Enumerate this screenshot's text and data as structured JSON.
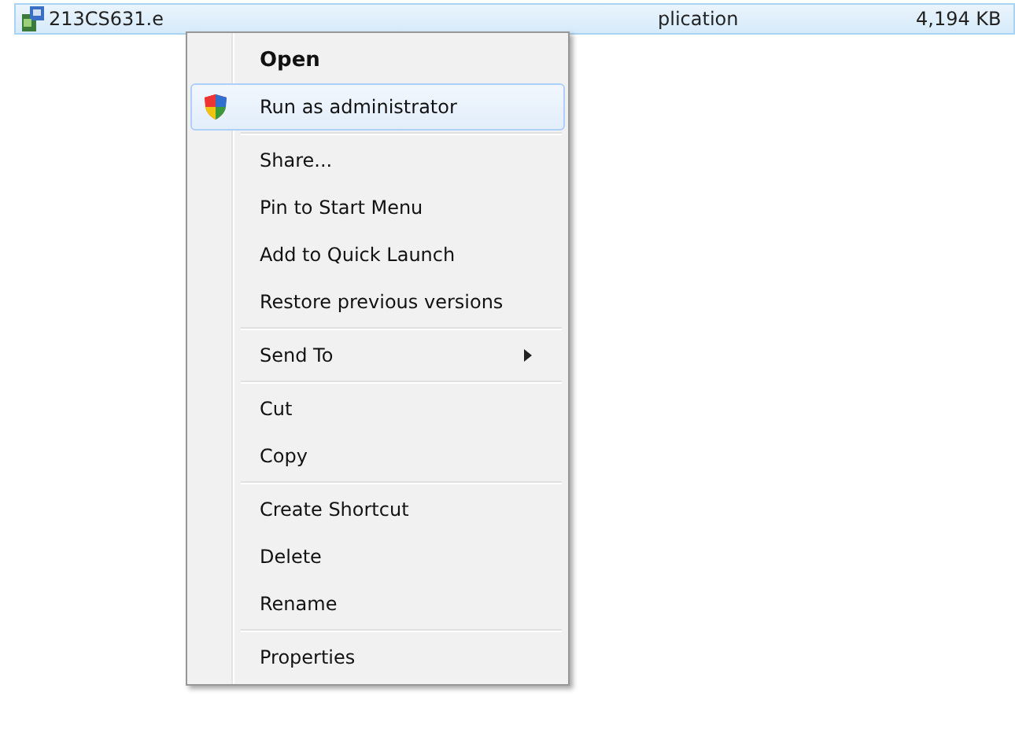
{
  "file_row": {
    "name": "213CS631.e",
    "type": "plication",
    "size": "4,194 KB",
    "selected": true
  },
  "context_menu": {
    "groups": [
      [
        {
          "label": "Open",
          "kind": "default",
          "selected": false
        },
        {
          "label": "Run as administrator",
          "kind": "elevated",
          "selected": true
        }
      ],
      [
        {
          "label": "Share...",
          "kind": "plain",
          "selected": false
        },
        {
          "label": "Pin to Start Menu",
          "kind": "plain",
          "selected": false
        },
        {
          "label": "Add to Quick Launch",
          "kind": "plain",
          "selected": false
        },
        {
          "label": "Restore previous versions",
          "kind": "plain",
          "selected": false
        }
      ],
      [
        {
          "label": "Send To",
          "kind": "submenu",
          "selected": false
        }
      ],
      [
        {
          "label": "Cut",
          "kind": "plain",
          "selected": false
        },
        {
          "label": "Copy",
          "kind": "plain",
          "selected": false
        }
      ],
      [
        {
          "label": "Create Shortcut",
          "kind": "plain",
          "selected": false
        },
        {
          "label": "Delete",
          "kind": "plain",
          "selected": false
        },
        {
          "label": "Rename",
          "kind": "plain",
          "selected": false
        }
      ],
      [
        {
          "label": "Properties",
          "kind": "plain",
          "selected": false
        }
      ]
    ]
  }
}
